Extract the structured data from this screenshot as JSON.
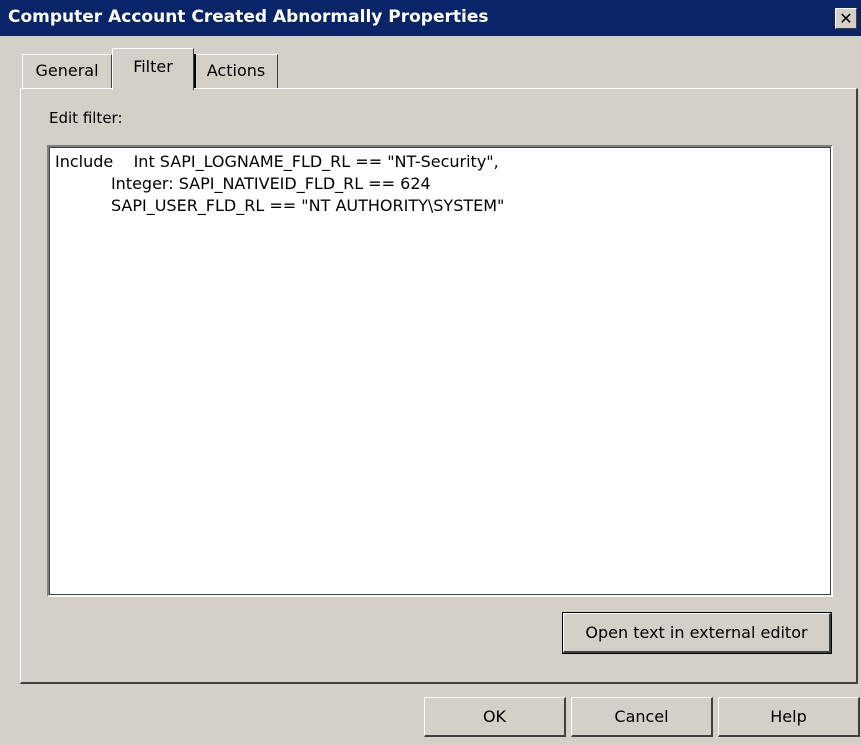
{
  "window": {
    "title": "Computer Account Created Abnormally Properties",
    "close_label": "✕"
  },
  "tabs": [
    {
      "label": "General",
      "selected": false
    },
    {
      "label": "Filter",
      "selected": true
    },
    {
      "label": "Actions",
      "selected": false
    }
  ],
  "filter_panel": {
    "edit_label": "Edit filter:",
    "lines": [
      "Include    Int SAPI_LOGNAME_FLD_RL == \"NT-Security\",",
      "           Integer: SAPI_NATIVEID_FLD_RL == 624",
      "           SAPI_USER_FLD_RL == \"NT AUTHORITY\\SYSTEM\""
    ],
    "external_editor_label": "Open text in external editor"
  },
  "footer": {
    "ok_label": "OK",
    "cancel_label": "Cancel",
    "help_label": "Help"
  },
  "colors": {
    "titlebar": "#0a246a",
    "face": "#d4d0c8"
  }
}
